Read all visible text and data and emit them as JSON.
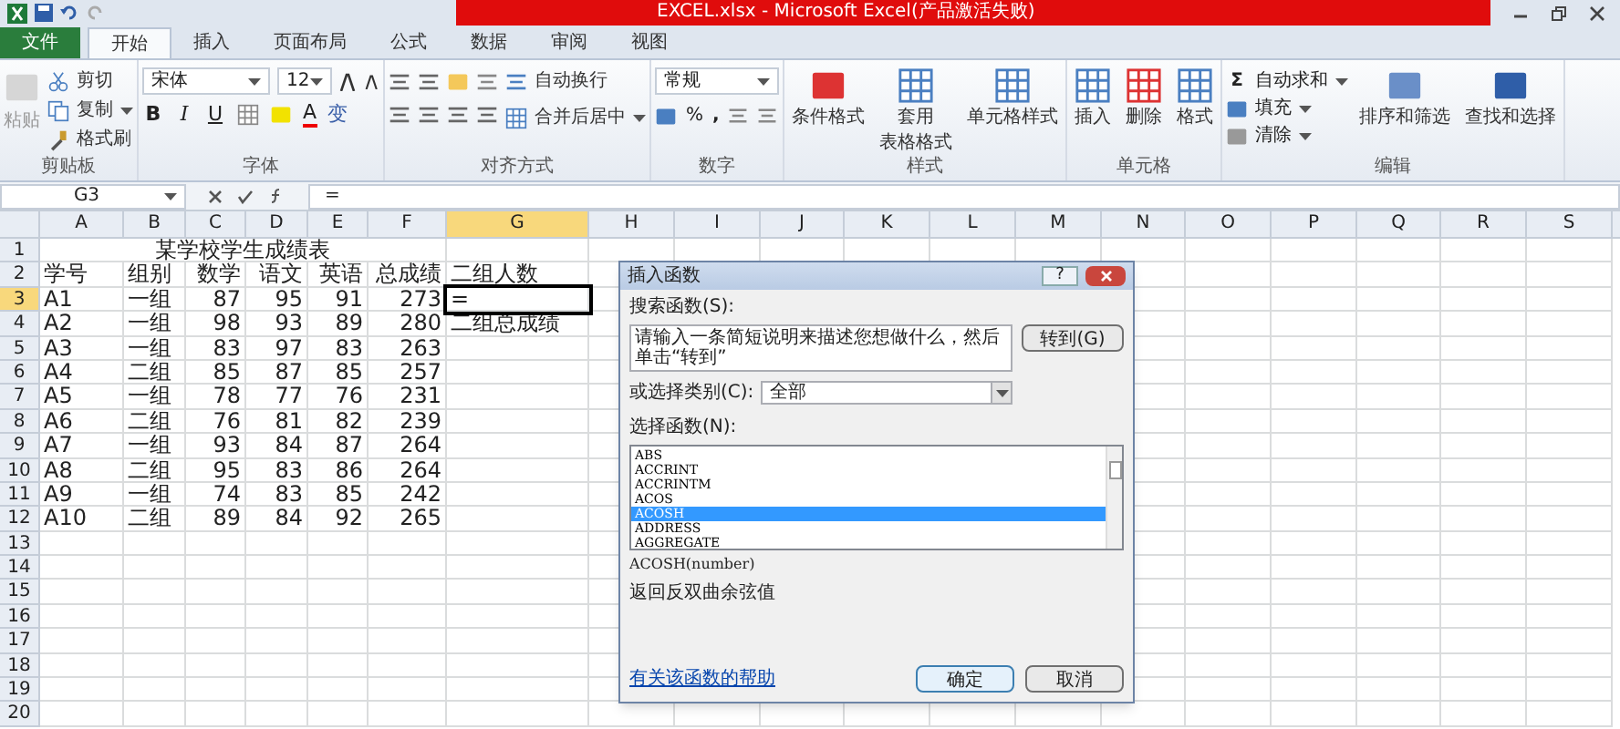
{
  "window": {
    "title": "EXCEL.xlsx - Microsoft Excel(产品激活失败)"
  },
  "ribbon_tabs": [
    {
      "label": "文件",
      "kind": "file",
      "selected": false
    },
    {
      "label": "开始",
      "kind": "tab",
      "selected": true
    },
    {
      "label": "插入",
      "kind": "tab",
      "selected": false
    },
    {
      "label": "页面布局",
      "kind": "tab",
      "selected": false
    },
    {
      "label": "公式",
      "kind": "tab",
      "selected": false
    },
    {
      "label": "数据",
      "kind": "tab",
      "selected": false
    },
    {
      "label": "审阅",
      "kind": "tab",
      "selected": false
    },
    {
      "label": "视图",
      "kind": "tab",
      "selected": false
    }
  ],
  "clipboard": {
    "label": "剪贴板",
    "paste": {
      "label": "粘贴",
      "disabled": true
    },
    "items": [
      "剪切",
      "复制",
      "格式刷"
    ]
  },
  "font": {
    "label": "字体",
    "font_name": "宋体",
    "font_size": "12",
    "bold": "B",
    "italic": "I",
    "underline": "U",
    "font_color": "A",
    "phonetic": "变"
  },
  "alignment": {
    "label": "对齐方式",
    "wrap": "自动换行",
    "merge": "合并后居中"
  },
  "number": {
    "label": "数字",
    "format": "常规",
    "percent": "%",
    "comma": ","
  },
  "styles": {
    "label": "样式",
    "items": [
      [
        "条件格式"
      ],
      [
        "套用",
        "表格格式"
      ],
      [
        "单元格样式"
      ]
    ]
  },
  "cells": {
    "label": "单元格",
    "items": [
      "插入",
      "删除",
      "格式"
    ]
  },
  "editing": {
    "label": "编辑",
    "sum_sign": "Σ",
    "items": [
      "自动求和",
      "填充",
      "清除"
    ],
    "large": [
      "排序和筛选",
      "查找和选择"
    ]
  },
  "formula_bar": {
    "name_box": "G3",
    "formula": "="
  },
  "sheet": {
    "columns": [
      {
        "label": "A",
        "selected": false
      },
      {
        "label": "B",
        "selected": false
      },
      {
        "label": "C",
        "selected": false
      },
      {
        "label": "D",
        "selected": false
      },
      {
        "label": "E",
        "selected": false
      },
      {
        "label": "F",
        "selected": false
      },
      {
        "label": "G",
        "selected": true
      },
      {
        "label": "H",
        "selected": false
      },
      {
        "label": "I",
        "selected": false
      },
      {
        "label": "J",
        "selected": false
      },
      {
        "label": "K",
        "selected": false
      },
      {
        "label": "L",
        "selected": false
      },
      {
        "label": "M",
        "selected": false
      },
      {
        "label": "N",
        "selected": false
      },
      {
        "label": "O",
        "selected": false
      },
      {
        "label": "P",
        "selected": false
      },
      {
        "label": "Q",
        "selected": false
      },
      {
        "label": "R",
        "selected": false
      },
      {
        "label": "S",
        "selected": false
      }
    ],
    "title": "某学校学生成绩表",
    "rows": [
      {
        "number": "1",
        "selected": false,
        "cells": []
      },
      {
        "number": "2",
        "selected": false,
        "cells": [
          "学号",
          "组别",
          "数学",
          "语文",
          "英语",
          "总成绩",
          "二组人数"
        ]
      },
      {
        "number": "3",
        "selected": true,
        "cells": [
          "A1",
          "一组",
          "87",
          "95",
          "91",
          "273",
          "="
        ]
      },
      {
        "number": "4",
        "selected": false,
        "cells": [
          "A2",
          "一组",
          "98",
          "93",
          "89",
          "280",
          "二组总成绩"
        ]
      },
      {
        "number": "5",
        "selected": false,
        "cells": [
          "A3",
          "一组",
          "83",
          "97",
          "83",
          "263"
        ]
      },
      {
        "number": "6",
        "selected": false,
        "cells": [
          "A4",
          "二组",
          "85",
          "87",
          "85",
          "257"
        ]
      },
      {
        "number": "7",
        "selected": false,
        "cells": [
          "A5",
          "一组",
          "78",
          "77",
          "76",
          "231"
        ]
      },
      {
        "number": "8",
        "selected": false,
        "cells": [
          "A6",
          "二组",
          "76",
          "81",
          "82",
          "239"
        ]
      },
      {
        "number": "9",
        "selected": false,
        "cells": [
          "A7",
          "一组",
          "93",
          "84",
          "87",
          "264"
        ]
      },
      {
        "number": "10",
        "selected": false,
        "cells": [
          "A8",
          "二组",
          "95",
          "83",
          "86",
          "264"
        ]
      },
      {
        "number": "11",
        "selected": false,
        "cells": [
          "A9",
          "一组",
          "74",
          "83",
          "85",
          "242"
        ]
      },
      {
        "number": "12",
        "selected": false,
        "cells": [
          "A10",
          "二组",
          "89",
          "84",
          "92",
          "265"
        ]
      },
      {
        "number": "13",
        "selected": false,
        "cells": []
      },
      {
        "number": "14",
        "selected": false,
        "cells": []
      },
      {
        "number": "15",
        "selected": false,
        "cells": []
      },
      {
        "number": "16",
        "selected": false,
        "cells": []
      },
      {
        "number": "17",
        "selected": false,
        "cells": []
      },
      {
        "number": "18",
        "selected": false,
        "cells": []
      },
      {
        "number": "19",
        "selected": false,
        "cells": []
      },
      {
        "number": "20",
        "selected": false,
        "cells": []
      }
    ]
  },
  "dialog": {
    "title": "插入函数",
    "help": "?",
    "search_label": "搜索函数(S):",
    "search_value": "请输入一条简短说明来描述您想做什么，然后单击“转到”",
    "go_button": "转到(G)",
    "category_label": "或选择类别(C):",
    "category_value": "全部",
    "list_label": "选择函数(N):",
    "functions": [
      {
        "label": "ABS",
        "selected": false
      },
      {
        "label": "ACCRINT",
        "selected": false
      },
      {
        "label": "ACCRINTM",
        "selected": false
      },
      {
        "label": "ACOS",
        "selected": false
      },
      {
        "label": "ACOSH",
        "selected": true
      },
      {
        "label": "ADDRESS",
        "selected": false
      },
      {
        "label": "AGGREGATE",
        "selected": false
      }
    ],
    "signature": "ACOSH(number)",
    "description": "返回反双曲余弦值",
    "help_link": "有关该函数的帮助",
    "ok": "确定",
    "cancel": "取消"
  }
}
